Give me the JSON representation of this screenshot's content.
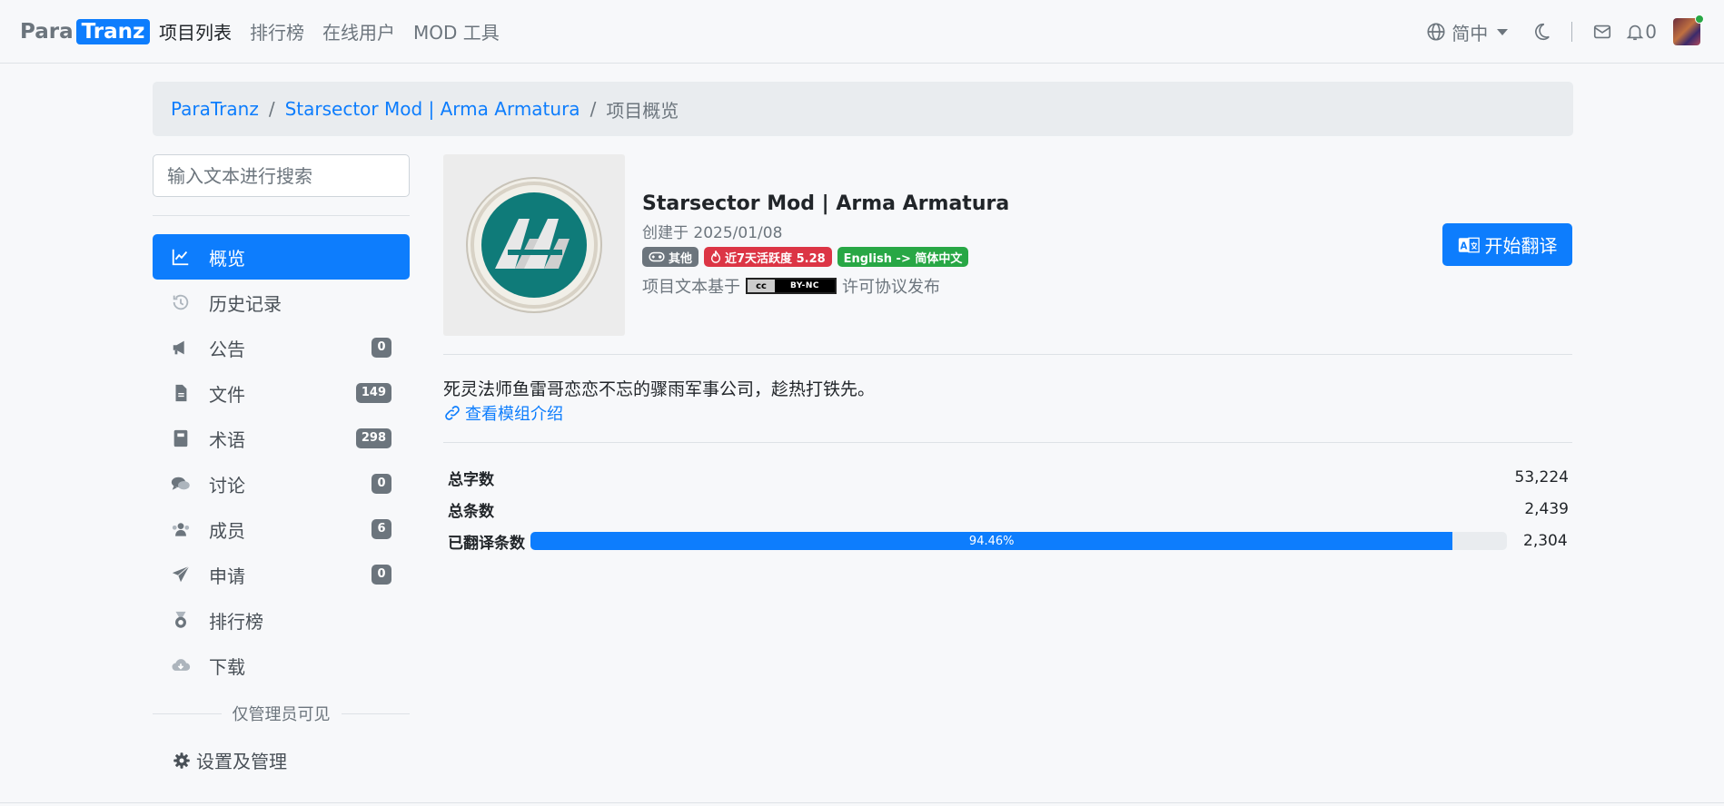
{
  "header": {
    "brand_para": "Para",
    "brand_tranz": "Tranz",
    "nav": [
      {
        "label": "项目列表"
      },
      {
        "label": "排行榜"
      },
      {
        "label": "在线用户"
      },
      {
        "label": "MOD 工具"
      }
    ],
    "lang_label": "简中",
    "notif_count": "0"
  },
  "breadcrumb": {
    "root": "ParaTranz",
    "project": "Starsector Mod | Arma Armatura",
    "current": "项目概览",
    "divider": "/"
  },
  "sidebar": {
    "search_placeholder": "输入文本进行搜索",
    "items": [
      {
        "label": "概览",
        "icon": "chart-line-icon"
      },
      {
        "label": "历史记录",
        "icon": "history-icon"
      },
      {
        "label": "公告",
        "icon": "megaphone-icon",
        "badge": "0"
      },
      {
        "label": "文件",
        "icon": "file-icon",
        "badge": "149"
      },
      {
        "label": "术语",
        "icon": "book-icon",
        "badge": "298"
      },
      {
        "label": "讨论",
        "icon": "comments-icon",
        "badge": "0"
      },
      {
        "label": "成员",
        "icon": "users-icon",
        "badge": "6"
      },
      {
        "label": "申请",
        "icon": "paper-plane-icon",
        "badge": "0"
      },
      {
        "label": "排行榜",
        "icon": "medal-icon"
      },
      {
        "label": "下载",
        "icon": "cloud-download-icon"
      }
    ],
    "admin_divider": "仅管理员可见",
    "settings_label": "设置及管理"
  },
  "project": {
    "title": "Starsector Mod | Arma Armatura",
    "created": "创建于 2025/01/08",
    "tags": {
      "category": "其他",
      "activity": "近7天活跃度 5.28",
      "langs": "English -> 简体中文"
    },
    "license_prefix": "项目文本基于",
    "license_badge_left": "cc",
    "license_badge_right": "BY-NC",
    "license_suffix": "许可协议发布",
    "start_button": "开始翻译",
    "description": "死灵法师鱼雷哥恋恋不忘的骤雨军事公司，趁热打铁先。",
    "mod_link": "查看模组介绍"
  },
  "stats": {
    "total_words_label": "总字数",
    "total_words": "53,224",
    "total_entries_label": "总条数",
    "total_entries": "2,439",
    "translated_label": "已翻译条数",
    "translated": "2,304",
    "progress_text": "94.46%",
    "progress_fraction": 0.9446
  },
  "colors": {
    "primary": "#0d7dfd",
    "badge_gray": "#6c757d",
    "danger": "#dc3545",
    "success": "#28a745"
  }
}
